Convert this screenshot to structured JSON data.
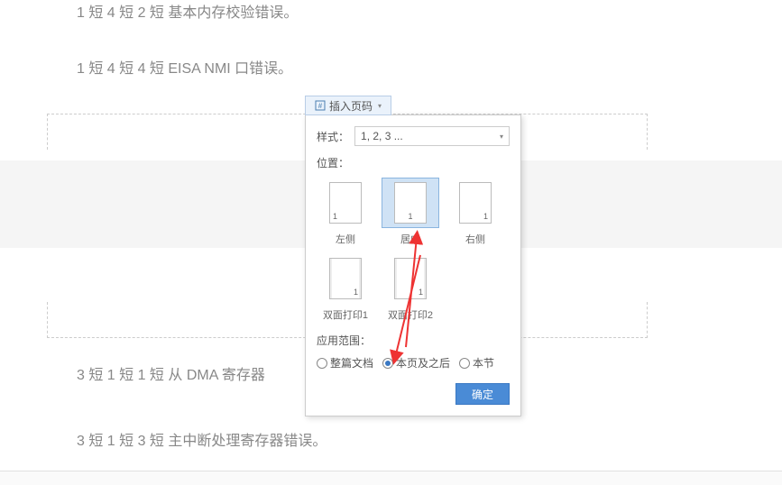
{
  "doc": {
    "line1": "1 短 4 短 2 短  基本内存校验错误。",
    "line2": "1 短 4 短 4 短  EISA  NMI 口错误。",
    "line3": "3 短 1 短 1 短  从 DMA 寄存器",
    "line4": "3 短 1 短 3 短  主中断处理寄存器错误。"
  },
  "insert_btn": {
    "label": "插入页码"
  },
  "popup": {
    "style_label": "样式：",
    "style_value": "1, 2, 3 ...",
    "pos_label": "位置：",
    "thumbs": {
      "left": "左侧",
      "center": "居中",
      "right": "右侧",
      "duplex1": "双面打印1",
      "duplex2": "双面打印2",
      "page_num": "1"
    },
    "scope_label": "应用范围：",
    "radios": {
      "whole": "整篇文档",
      "from_here": "本页及之后",
      "section": "本节"
    },
    "ok": "确定"
  }
}
